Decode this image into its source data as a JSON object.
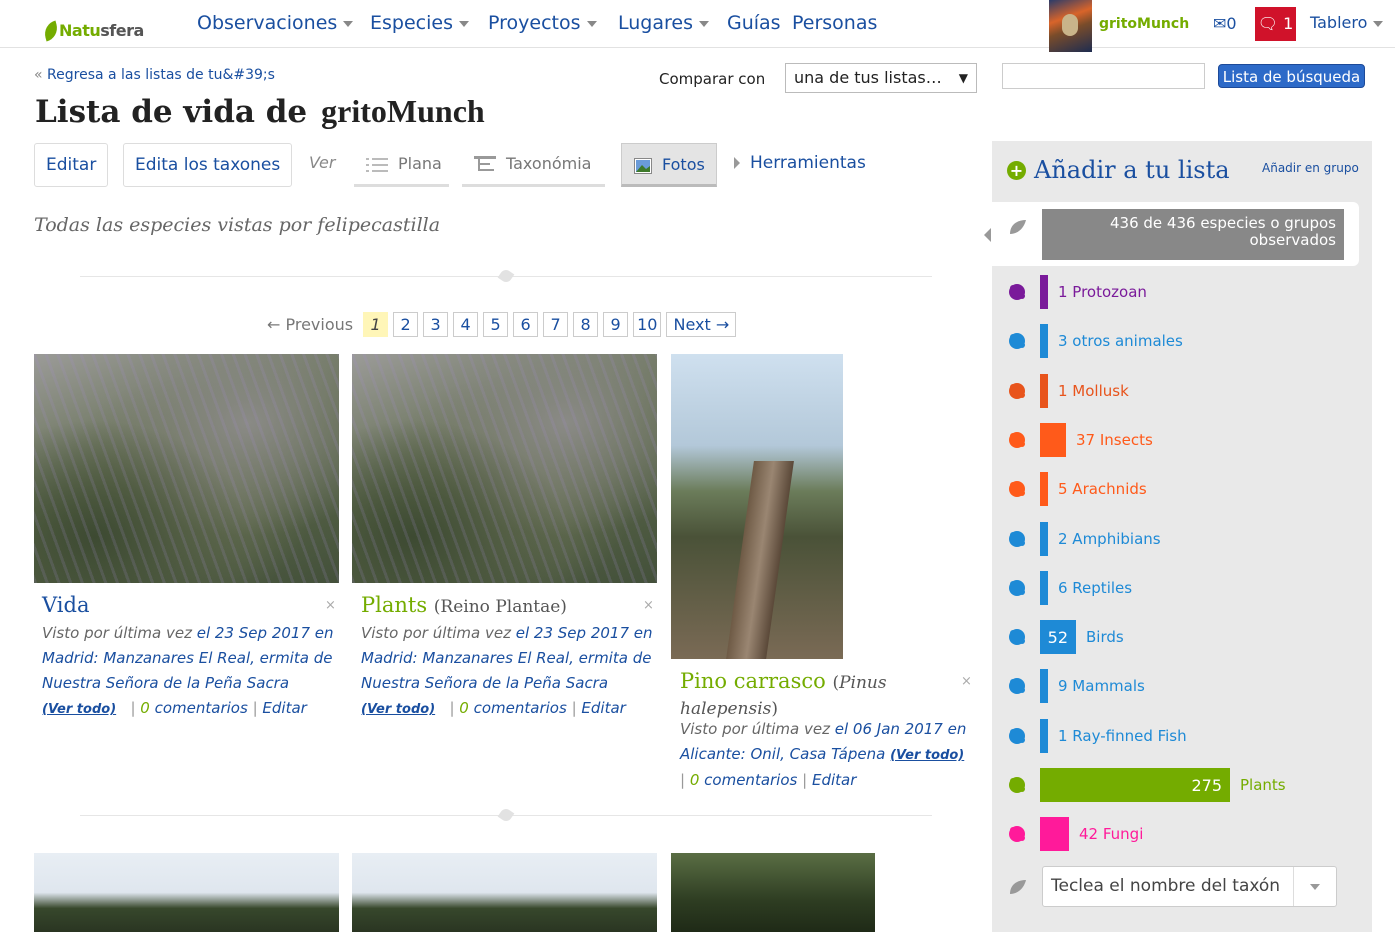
{
  "nav": {
    "logo_first": "N",
    "logo_mid": "atu",
    "logo_rest": "sfera",
    "items": [
      {
        "label": "Observaciones",
        "caret": true
      },
      {
        "label": "Especies",
        "caret": true
      },
      {
        "label": "Proyectos",
        "caret": true
      },
      {
        "label": "Lugares",
        "caret": true
      },
      {
        "label": "Guías",
        "caret": false
      },
      {
        "label": "Personas",
        "caret": false
      }
    ],
    "username": "gritoMunch",
    "messages": "✉0",
    "notifications": "1",
    "dashboard": "Tablero"
  },
  "header": {
    "back_arrow": "«",
    "back_link": "Regresa a las listas de tu&#39;s",
    "compare_label": "Comparar con",
    "compare_value": "una de tus listas…",
    "search_button": "Lista de búsqueda",
    "title": "Lista de vida de",
    "title_user": "gritoMunch"
  },
  "toolbar": {
    "edit": "Editar",
    "edit_taxa": "Edita los taxones",
    "view_label": "Ver",
    "view_flat": "Plana",
    "view_taxonomy": "Taxonómia",
    "view_photos": "Fotos",
    "tools": "Herramientas"
  },
  "subtitle": "Todas las especies vistas por felipecastilla",
  "pagination": {
    "previous": "← Previous",
    "pages": [
      "1",
      "2",
      "3",
      "4",
      "5",
      "6",
      "7",
      "8",
      "9",
      "10"
    ],
    "current": "1",
    "next": "Next →"
  },
  "cards": [
    {
      "title": "Vida",
      "sci": "",
      "seen_prefix": "Visto por última vez",
      "date": "el 23 Sep 2017",
      "place": "Madrid: Manzanares El Real, ermita de Nuestra Señora de la Peña Sacra",
      "see_all": "(Ver todo)",
      "comments_count": "0",
      "comments": "comentarios",
      "edit": "Editar"
    },
    {
      "title": "Plants",
      "sci": "(Reino Plantae)",
      "seen_prefix": "Visto por última vez",
      "date": "el 23 Sep 2017",
      "place": "Madrid: Manzanares El Real, ermita de Nuestra Señora de la Peña Sacra",
      "see_all": "(Ver todo)",
      "comments_count": "0",
      "comments": "comentarios",
      "edit": "Editar"
    },
    {
      "title": "Pino carrasco",
      "sci_open": "(",
      "sci_name": "Pinus halepensis",
      "sci_close": ")",
      "seen_prefix": "Visto por última vez",
      "date": "el 06 Jan 2017",
      "place": "Alicante: Onil, Casa Tápena",
      "see_all": "(Ver todo)",
      "comments_count": "0",
      "comments": "comentarios",
      "edit": "Editar"
    }
  ],
  "card_close": "×",
  "sidebar": {
    "add_title": "Añadir a tu lista",
    "add_group": "Añadir en grupo",
    "total": "436 de 436 especies o grupos observados",
    "taxa": [
      {
        "count": "1",
        "name": "Protozoan",
        "color": "#7a1a9a",
        "fraction": 0
      },
      {
        "count": "3",
        "name": "otros animales",
        "color": "#1e8ad6",
        "fraction": 0
      },
      {
        "count": "1",
        "name": "Mollusk",
        "color": "#e8541c",
        "fraction": 0
      },
      {
        "count": "37",
        "name": "Insects",
        "color": "#ff5a1a",
        "fraction": 0.135
      },
      {
        "count": "5",
        "name": "Arachnids",
        "color": "#ff5a1a",
        "fraction": 0.018
      },
      {
        "count": "2",
        "name": "Amphibians",
        "color": "#1e8ad6",
        "fraction": 0
      },
      {
        "count": "6",
        "name": "Reptiles",
        "color": "#1e8ad6",
        "fraction": 0.022
      },
      {
        "count": "52",
        "name": "Birds",
        "color": "#1e8ad6",
        "fraction": 0.189
      },
      {
        "count": "9",
        "name": "Mammals",
        "color": "#1e8ad6",
        "fraction": 0.033
      },
      {
        "count": "1",
        "name": "Ray-finned Fish",
        "color": "#1e8ad6",
        "fraction": 0
      },
      {
        "count": "275",
        "name": "Plants",
        "color": "#74ac00",
        "fraction": 1
      },
      {
        "count": "42",
        "name": "Fungi",
        "color": "#ff1a9a",
        "fraction": 0.153
      }
    ],
    "taxon_placeholder": "Teclea el nombre del taxón"
  }
}
